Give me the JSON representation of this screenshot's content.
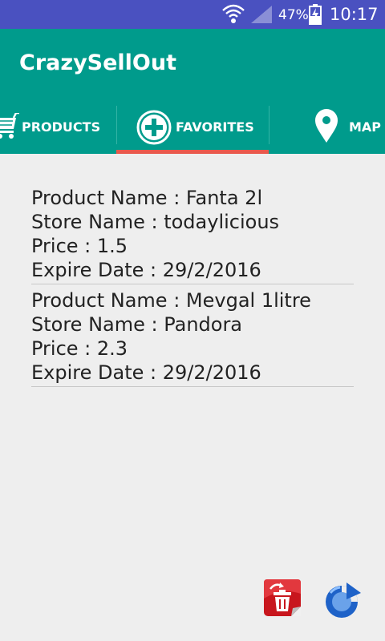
{
  "status_bar": {
    "battery_percent": "47%",
    "time": "10:17"
  },
  "app": {
    "title": "CrazySellOut"
  },
  "tabs": [
    {
      "label": "PRODUCTS",
      "icon": "shopping-cart-icon"
    },
    {
      "label": "FAVORITES",
      "icon": "plus-circle-icon"
    },
    {
      "label": "MAP",
      "icon": "map-pin-icon"
    }
  ],
  "selected_tab": "FAVORITES",
  "favorites": [
    {
      "product": "Product Name : Fanta 2l",
      "store": "Store Name : todaylicious",
      "price": "Price : 1.5",
      "expire": "Expire Date : 29/2/2016"
    },
    {
      "product": "Product Name : Mevgal 1litre",
      "store": "Store Name : Pandora",
      "price": "Price : 2.3",
      "expire": "Expire Date : 29/2/2016"
    }
  ],
  "actions": {
    "delete_icon": "trash-icon",
    "refresh_icon": "refresh-icon"
  },
  "colors": {
    "status_bar": "#4a51c0",
    "primary": "#009b8c",
    "tab_indicator": "#e9594d",
    "background": "#eeeeee"
  }
}
